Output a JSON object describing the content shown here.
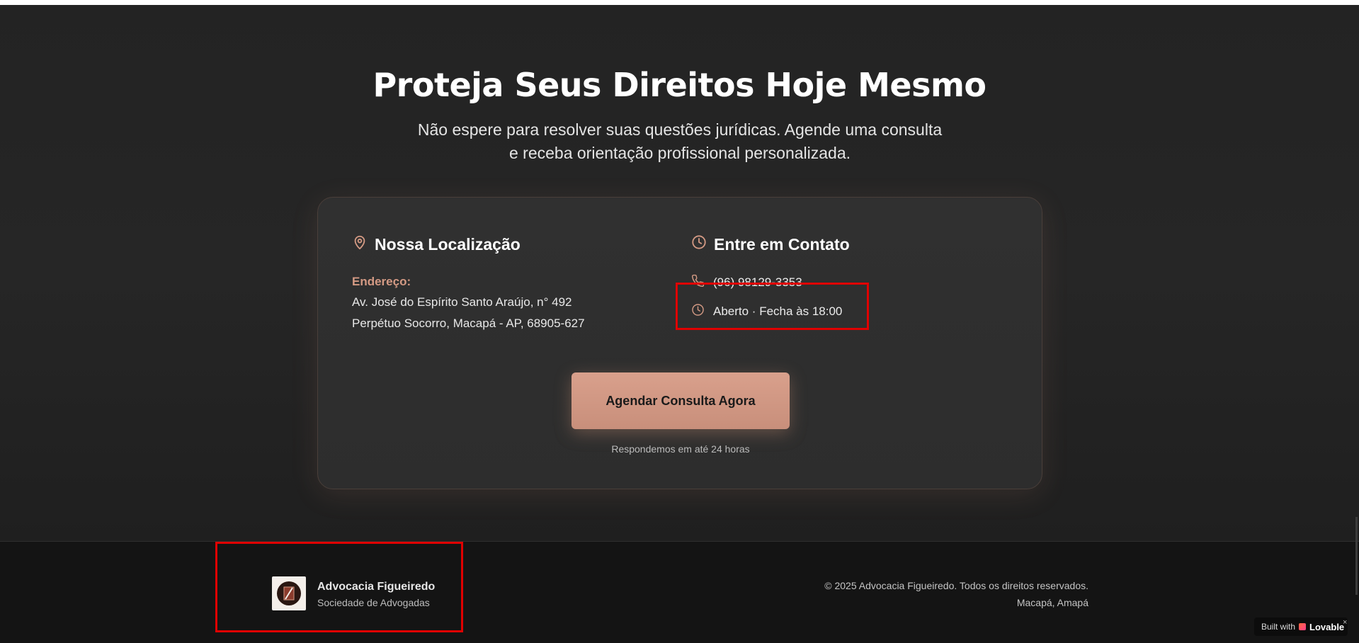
{
  "hero": {
    "title": "Proteja Seus Direitos Hoje Mesmo",
    "subtitle_line1": "Não espere para resolver suas questões jurídicas. Agende uma consulta",
    "subtitle_line2": "e receba orientação profissional personalizada."
  },
  "location": {
    "title": "Nossa Localização",
    "icon": "map-pin-icon",
    "address_label": "Endereço:",
    "address_line1": "Av. José do Espírito Santo Araújo, n° 492",
    "address_line2": "Perpétuo Socorro, Macapá - AP, 68905-627"
  },
  "contact": {
    "title": "Entre em Contato",
    "icon": "clock-icon",
    "phone": "(96) 98129-3353",
    "hours": "Aberto · Fecha às 18:00"
  },
  "cta": {
    "button_label": "Agendar Consulta Agora",
    "note": "Respondemos em até 24 horas"
  },
  "footer": {
    "brand_name": "Advocacia Figueiredo",
    "brand_tagline": "Sociedade de Advogadas",
    "copyright": "© 2025 Advocacia Figueiredo. Todos os direitos reservados.",
    "location": "Macapá, Amapá"
  },
  "badge": {
    "prefix": "Built with",
    "brand": "Lovable",
    "close": "×"
  },
  "colors": {
    "accent": "#d49a84",
    "button": "#d9a08c",
    "background": "#232323",
    "footer": "#141414",
    "highlight": "#e00000"
  }
}
